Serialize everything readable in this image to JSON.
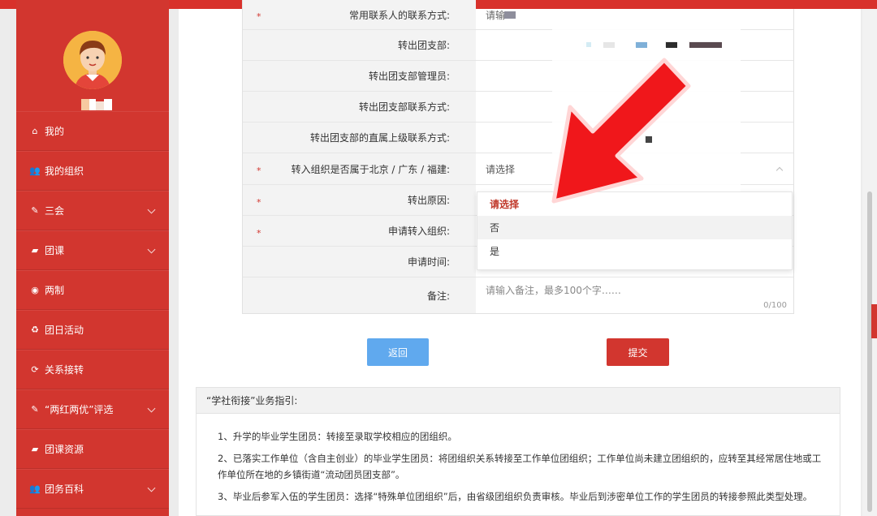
{
  "sidebar": {
    "items": [
      {
        "icon": "⌂",
        "icon_name": "home-icon",
        "label": "我的",
        "has_chevron": false
      },
      {
        "icon": "👥",
        "icon_name": "users-icon",
        "label": "我的组织",
        "has_chevron": false
      },
      {
        "icon": "✎",
        "icon_name": "edit-icon",
        "label": "三会",
        "has_chevron": true
      },
      {
        "icon": "▰",
        "icon_name": "folder-icon",
        "label": "团课",
        "has_chevron": true
      },
      {
        "icon": "◉",
        "icon_name": "dot-circle-icon",
        "label": "两制",
        "has_chevron": false
      },
      {
        "icon": "♻",
        "icon_name": "recycle-icon",
        "label": "团日活动",
        "has_chevron": false
      },
      {
        "icon": "⟳",
        "icon_name": "refresh-icon",
        "label": "关系接转",
        "has_chevron": false
      },
      {
        "icon": "✎",
        "icon_name": "edit-icon",
        "label": "“两红两优”评选",
        "has_chevron": true
      },
      {
        "icon": "▰",
        "icon_name": "folder-icon",
        "label": "团课资源",
        "has_chevron": false
      },
      {
        "icon": "👥",
        "icon_name": "users-icon",
        "label": "团务百科",
        "has_chevron": true
      }
    ]
  },
  "form": {
    "rows": [
      {
        "label": "常用联系人的联系方式:",
        "required": true,
        "value": "请输",
        "value_type": "input"
      },
      {
        "label": "转出团支部:",
        "required": false,
        "value": "",
        "value_type": "text"
      },
      {
        "label": "转出团支部管理员:",
        "required": false,
        "value": "",
        "value_type": "text"
      },
      {
        "label": "转出团支部联系方式:",
        "required": false,
        "value": "",
        "value_type": "text"
      },
      {
        "label": "转出团支部的直属上级联系方式:",
        "required": false,
        "value": "",
        "value_type": "text"
      },
      {
        "label": "转入组织是否属于北京 / 广东 / 福建:",
        "required": true,
        "value": "请选择",
        "value_type": "select"
      },
      {
        "label": "转出原因:",
        "required": true,
        "value": "",
        "value_type": "text"
      },
      {
        "label": "申请转入组织:",
        "required": true,
        "value": "",
        "value_type": "text"
      },
      {
        "label": "申请时间:",
        "required": false,
        "value": "",
        "value_type": "text"
      }
    ],
    "remark_label": "备注:",
    "remark_placeholder": "请输入备注，最多100个字……",
    "remark_counter": "0/100",
    "required_mark": "*"
  },
  "dropdown": {
    "options": [
      {
        "label": "请选择",
        "state": "selected"
      },
      {
        "label": "否",
        "state": "hover"
      },
      {
        "label": "是",
        "state": "normal"
      }
    ]
  },
  "buttons": {
    "back": "返回",
    "submit": "提交"
  },
  "guide": {
    "title": "“学社衔接”业务指引:",
    "items": [
      "1、升学的毕业学生团员：转接至录取学校相应的团组织。",
      "2、已落实工作单位（含自主创业）的毕业学生团员：将团组织关系转接至工作单位团组织；工作单位尚未建立团组织的，应转至其经常居住地或工作单位所在地的乡镇街道“流动团员团支部”。",
      "3、毕业后参军入伍的学生团员：选择“特殊单位团组织”后，由省级团组织负责审核。毕业后到涉密单位工作的学生团员的转接参照此类型处理。"
    ]
  },
  "colors": {
    "brand_red": "#d2362f",
    "button_blue": "#60a9ee",
    "arrow_red": "#f0171b"
  }
}
